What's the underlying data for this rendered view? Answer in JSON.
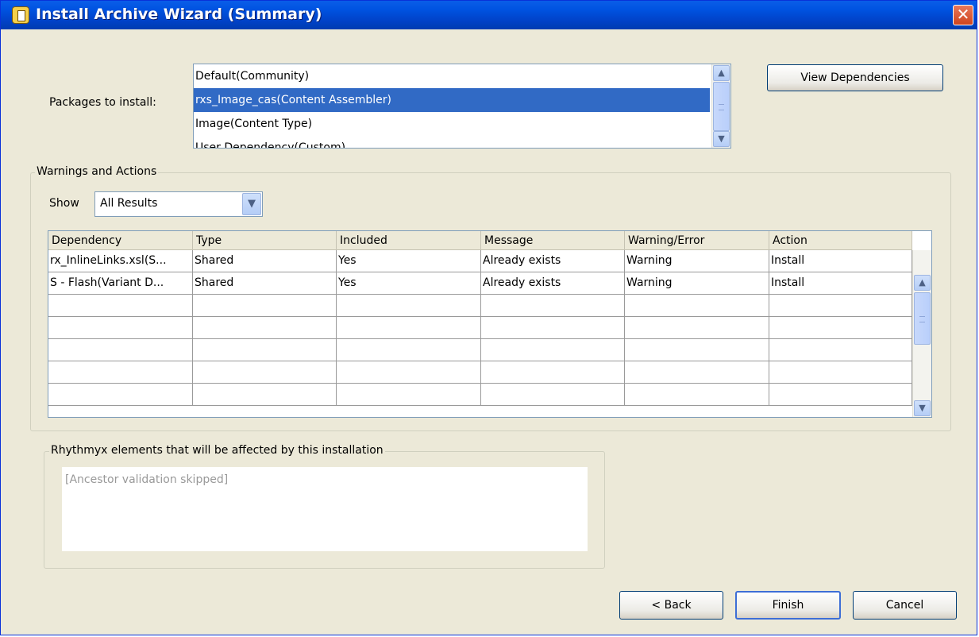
{
  "window": {
    "title": "Install Archive Wizard (Summary)",
    "close_glyph": "✕",
    "icon": "wizard-icon"
  },
  "packages": {
    "label": "Packages to install:",
    "items": [
      "Default(Community)",
      "rxs_Image_cas(Content Assembler)",
      "Image(Content Type)",
      "User Dependency(Custom)"
    ],
    "selected_index": 1
  },
  "view_dependencies_label": "View Dependencies",
  "warnings": {
    "legend": "Warnings and Actions",
    "show_label": "Show",
    "show_value": "All Results",
    "columns": [
      "Dependency",
      "Type",
      "Included",
      "Message",
      "Warning/Error",
      "Action"
    ],
    "rows": [
      [
        "rx_InlineLinks.xsl(S...",
        "Shared",
        "Yes",
        "Already exists",
        "Warning",
        "Install"
      ],
      [
        "S - Flash(Variant D...",
        "Shared",
        "Yes",
        "Already exists",
        "Warning",
        "Install"
      ],
      [
        "",
        "",
        "",
        "",
        "",
        ""
      ],
      [
        "",
        "",
        "",
        "",
        "",
        ""
      ],
      [
        "",
        "",
        "",
        "",
        "",
        ""
      ],
      [
        "",
        "",
        "",
        "",
        "",
        ""
      ],
      [
        "",
        "",
        "",
        "",
        "",
        ""
      ]
    ]
  },
  "affected": {
    "legend": "Rhythmyx elements that will be affected by this installation",
    "text": "[Ancestor validation skipped]"
  },
  "buttons": {
    "back": "< Back",
    "finish": "Finish",
    "cancel": "Cancel"
  },
  "colors": {
    "selection": "#316ac5",
    "titlebar": "#0053e1",
    "dialog_bg": "#ece9d8"
  }
}
